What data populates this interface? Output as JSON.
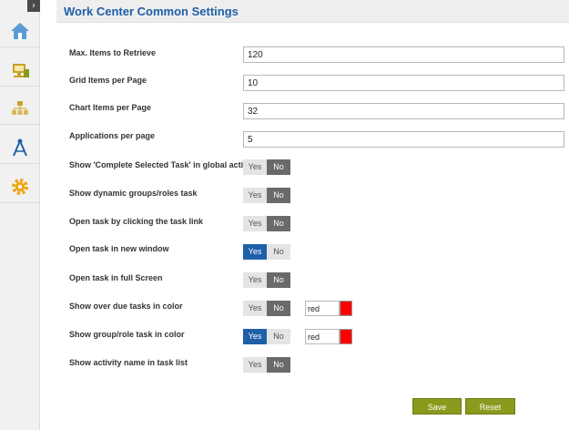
{
  "sidebar": {
    "toggle_glyph": "›",
    "items": [
      {
        "icon": "home-icon",
        "color": "#5b9bd5"
      },
      {
        "icon": "computer-icon",
        "color": "#c9a227"
      },
      {
        "icon": "hierarchy-icon",
        "color": "#c9a227"
      },
      {
        "icon": "compass-icon",
        "color": "#1f5fa8"
      },
      {
        "icon": "gear-icon",
        "color": "#f0a30a"
      }
    ]
  },
  "header": {
    "title": "Work Center Common Settings"
  },
  "fields": {
    "max_items": {
      "label": "Max. Items to Retrieve",
      "value": "120"
    },
    "grid_items": {
      "label": "Grid Items per Page",
      "value": "10"
    },
    "chart_items": {
      "label": "Chart Items per Page",
      "value": "32"
    },
    "applications": {
      "label": "Applications per page",
      "value": "5"
    }
  },
  "toggles": {
    "complete_selected": {
      "label": "Show 'Complete Selected Task' in global action",
      "yes": "Yes",
      "no": "No",
      "selected": "No"
    },
    "dynamic_groups": {
      "label": "Show dynamic groups/roles task",
      "yes": "Yes",
      "no": "No",
      "selected": "No"
    },
    "open_by_link": {
      "label": "Open task by clicking the task link",
      "yes": "Yes",
      "no": "No",
      "selected": "No"
    },
    "new_window": {
      "label": "Open task in new window",
      "yes": "Yes",
      "no": "No",
      "selected": "Yes"
    },
    "full_screen": {
      "label": "Open task in full Screen",
      "yes": "Yes",
      "no": "No",
      "selected": "No"
    },
    "overdue_color": {
      "label": "Show over due tasks in color",
      "yes": "Yes",
      "no": "No",
      "selected": "No",
      "color_value": "red",
      "swatch": "#ff0000"
    },
    "group_role_color": {
      "label": "Show group/role task in color",
      "yes": "Yes",
      "no": "No",
      "selected": "Yes",
      "color_value": "red",
      "swatch": "#ff0000"
    },
    "activity_name": {
      "label": "Show activity name in task list",
      "yes": "Yes",
      "no": "No",
      "selected": "No"
    }
  },
  "actions": {
    "save_label": "Save",
    "reset_label": "Reset"
  },
  "colors": {
    "accent": "#1f5fa8",
    "button": "#8a9a1c"
  }
}
